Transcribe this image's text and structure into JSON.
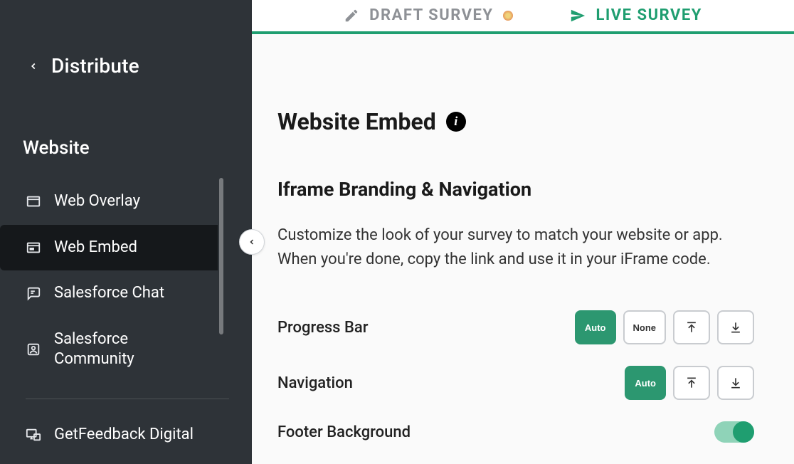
{
  "sidebar": {
    "back_label": "Distribute",
    "section_label": "Website",
    "items": [
      {
        "label": "Web Overlay"
      },
      {
        "label": "Web Embed"
      },
      {
        "label": "Salesforce Chat"
      },
      {
        "label": "Salesforce Community"
      },
      {
        "label": "GetFeedback Digital"
      }
    ]
  },
  "tabs": {
    "draft": "DRAFT SURVEY",
    "live": "LIVE SURVEY"
  },
  "page": {
    "title": "Website Embed",
    "subtitle": "Iframe Branding & Navigation",
    "description": "Customize the look of your survey to match your website or app. When you're done, copy the link and use it in your iFrame code."
  },
  "settings": {
    "progress_bar": {
      "label": "Progress Bar",
      "options": {
        "auto": "Auto",
        "none": "None"
      }
    },
    "navigation": {
      "label": "Navigation",
      "options": {
        "auto": "Auto"
      }
    },
    "footer_bg": {
      "label": "Footer Background",
      "value": true
    }
  }
}
